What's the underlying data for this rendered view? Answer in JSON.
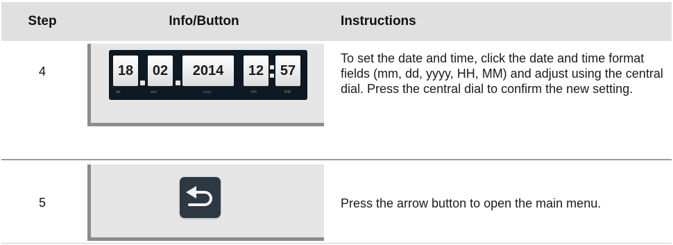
{
  "header": {
    "step": "Step",
    "info": "Info/Button",
    "instructions": "Instructions"
  },
  "rows": [
    {
      "step": "4",
      "display": {
        "day": "18",
        "month": "02",
        "year": "2014",
        "hour": "12",
        "minute": "57",
        "field_labels": [
          "dd",
          "mm",
          "yyyy",
          "HH",
          "MM"
        ]
      },
      "instructions": "To set the date and time, click the date and time format fields (mm, dd, yyyy, HH, MM) and adjust using the central dial. Press the central dial to confirm the new setting."
    },
    {
      "step": "5",
      "button_icon": "back-arrow-icon",
      "instructions": "Press the arrow button to open the main menu."
    }
  ],
  "colors": {
    "header_bg": "#e0e0e0",
    "panel_bg": "#e6e6e6",
    "panel_border": "#8c8c8c",
    "clock_bg": "#0d1a24",
    "button_bg": "#2c3942"
  }
}
